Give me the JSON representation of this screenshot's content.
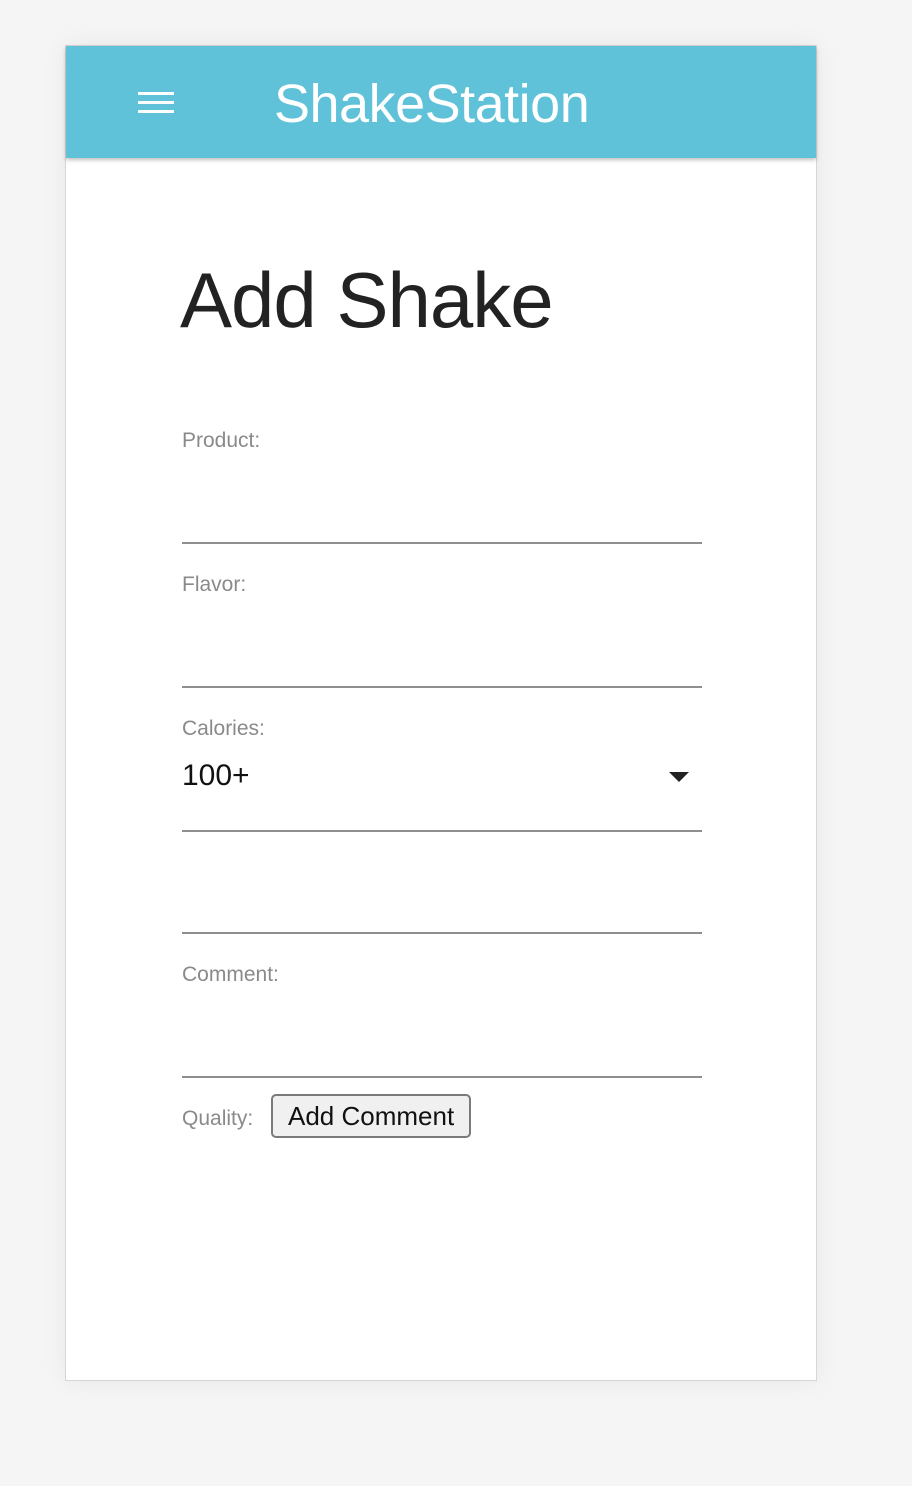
{
  "app": {
    "title": "ShakeStation",
    "menu_icon": "menu-icon"
  },
  "page": {
    "title": "Add Shake"
  },
  "form": {
    "product": {
      "label": "Product:",
      "value": ""
    },
    "flavor": {
      "label": "Flavor:",
      "value": ""
    },
    "calories": {
      "label": "Calories:",
      "selected": "100+",
      "icon": "chevron-down-icon"
    },
    "unlabeled_field": {
      "value": ""
    },
    "comment": {
      "label": "Comment:",
      "value": ""
    },
    "quality": {
      "label": "Quality:"
    },
    "add_comment_label": "Add Comment"
  },
  "colors": {
    "appbar": "#5fc2d9",
    "label_text": "#8a8a8a",
    "underline": "#8e8e8e"
  }
}
